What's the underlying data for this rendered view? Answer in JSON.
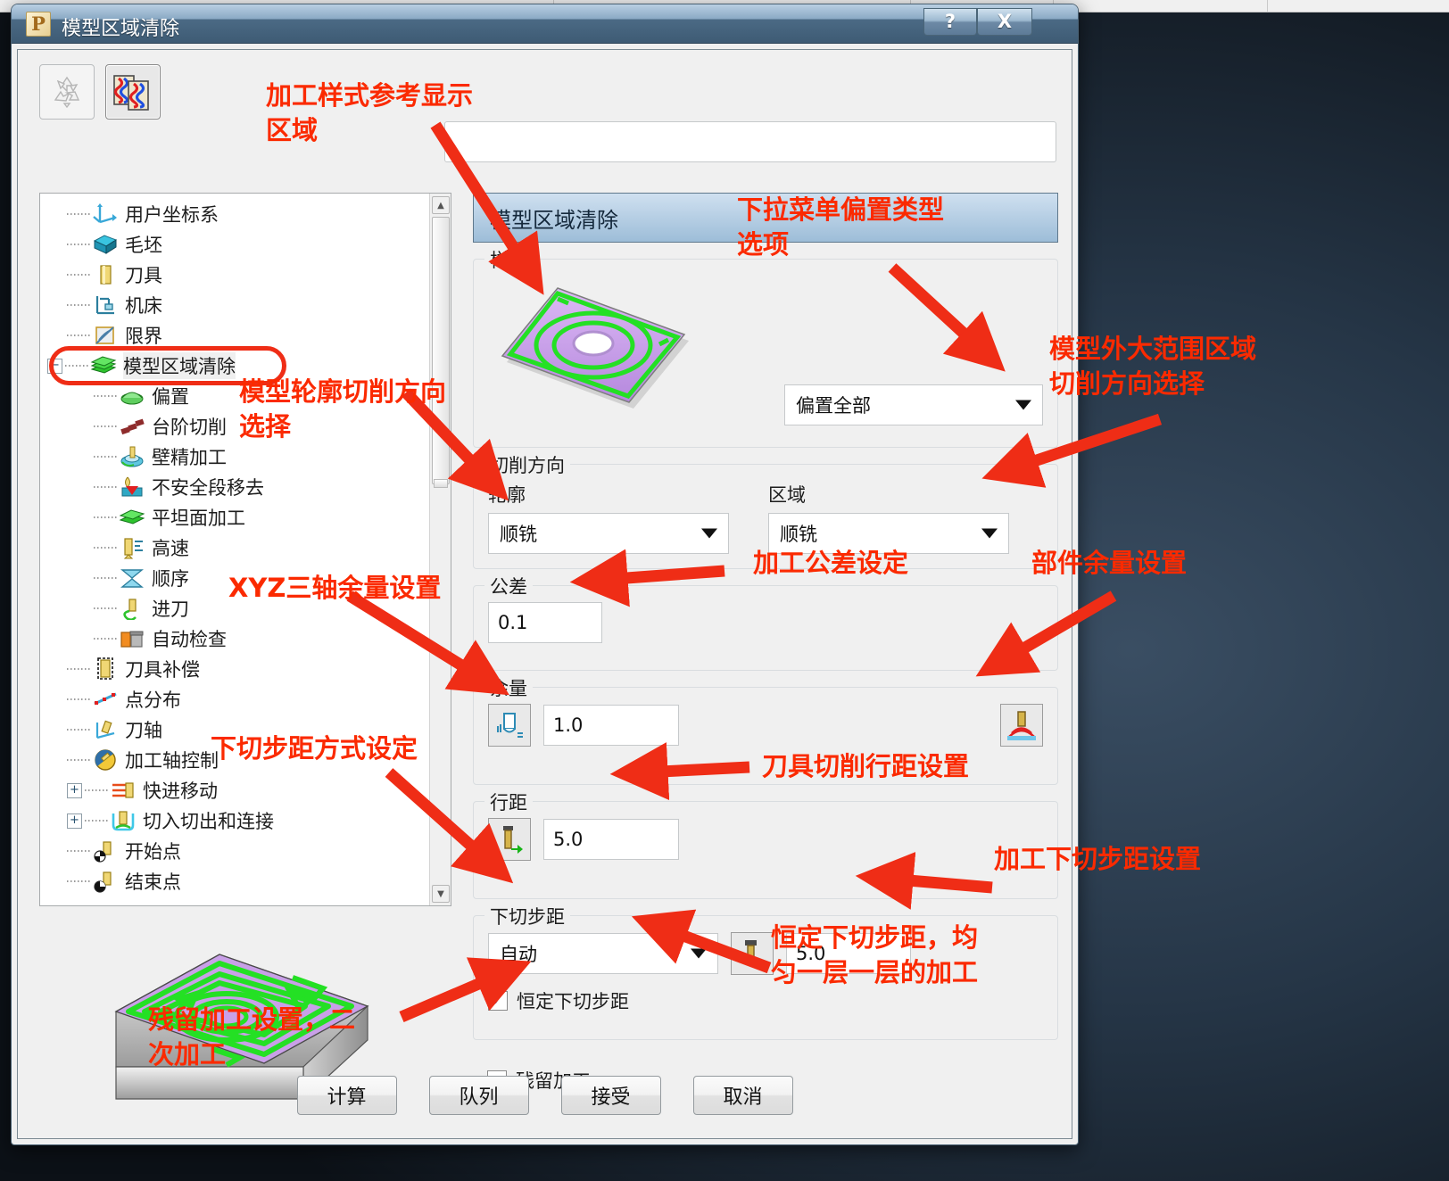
{
  "window": {
    "title": "模型区域清除",
    "app_icon_letter": "P",
    "help_button": "?",
    "close_button": "X"
  },
  "toolbar": {
    "buttons": [
      {
        "name": "recycle-icon",
        "label": ""
      },
      {
        "name": "toolpath-preview-icon",
        "label": ""
      }
    ]
  },
  "tree": {
    "items": [
      {
        "label": "用户坐标系",
        "icon": "axes-icon",
        "depth": 1,
        "expander": "",
        "selected": false
      },
      {
        "label": "毛坯",
        "icon": "block-icon",
        "depth": 1,
        "expander": "",
        "selected": false
      },
      {
        "label": "刀具",
        "icon": "tool-icon",
        "depth": 1,
        "expander": "",
        "selected": false
      },
      {
        "label": "机床",
        "icon": "machine-icon",
        "depth": 1,
        "expander": "",
        "selected": false
      },
      {
        "label": "限界",
        "icon": "limit-icon",
        "depth": 1,
        "expander": "",
        "selected": false
      },
      {
        "label": "模型区域清除",
        "icon": "area-clearance-icon",
        "depth": 0,
        "expander": "−",
        "selected": true
      },
      {
        "label": "偏置",
        "icon": "offset-icon",
        "depth": 2,
        "expander": "",
        "selected": false
      },
      {
        "label": "台阶切削",
        "icon": "step-cut-icon",
        "depth": 2,
        "expander": "",
        "selected": false
      },
      {
        "label": "壁精加工",
        "icon": "wall-finish-icon",
        "depth": 2,
        "expander": "",
        "selected": false
      },
      {
        "label": "不安全段移去",
        "icon": "unsafe-segment-icon",
        "depth": 2,
        "expander": "",
        "selected": false
      },
      {
        "label": "平坦面加工",
        "icon": "flat-machining-icon",
        "depth": 2,
        "expander": "",
        "selected": false
      },
      {
        "label": "高速",
        "icon": "high-speed-icon",
        "depth": 2,
        "expander": "",
        "selected": false
      },
      {
        "label": "顺序",
        "icon": "order-icon",
        "depth": 2,
        "expander": "",
        "selected": false
      },
      {
        "label": "进刀",
        "icon": "lead-in-icon",
        "depth": 2,
        "expander": "",
        "selected": false
      },
      {
        "label": "自动检查",
        "icon": "auto-check-icon",
        "depth": 2,
        "expander": "",
        "selected": false
      },
      {
        "label": "刀具补偿",
        "icon": "tool-compensation-icon",
        "depth": 1,
        "expander": "",
        "selected": false
      },
      {
        "label": "点分布",
        "icon": "point-distribution-icon",
        "depth": 1,
        "expander": "",
        "selected": false
      },
      {
        "label": "刀轴",
        "icon": "tool-axis-icon",
        "depth": 1,
        "expander": "",
        "selected": false
      },
      {
        "label": "加工轴控制",
        "icon": "machine-axis-control-icon",
        "depth": 1,
        "expander": "",
        "selected": false
      },
      {
        "label": "快进移动",
        "icon": "rapid-move-icon",
        "depth": 1,
        "expander": "+",
        "selected": false
      },
      {
        "label": "切入切出和连接",
        "icon": "lead-link-icon",
        "depth": 1,
        "expander": "+",
        "selected": false
      },
      {
        "label": "开始点",
        "icon": "start-point-icon",
        "depth": 1,
        "expander": "",
        "selected": false
      },
      {
        "label": "结束点",
        "icon": "end-point-icon",
        "depth": 1,
        "expander": "",
        "selected": false
      }
    ]
  },
  "form": {
    "header": "模型区域清除",
    "style_group": {
      "label": "样式",
      "preview_icon": "offset-all-pattern-icon",
      "offset_type": "偏置全部"
    },
    "cut_direction_group": {
      "label": "切削方向",
      "profile_label": "轮廓",
      "profile_value": "顺铣",
      "area_label": "区域",
      "area_value": "顺铣"
    },
    "tolerance_group": {
      "label": "公差",
      "value": "0.1"
    },
    "thickness_group": {
      "label": "余量",
      "icon_left": "radial-thickness-icon",
      "value": "1.0",
      "icon_right": "axial-thickness-icon"
    },
    "stepover_group": {
      "label": "行距",
      "icon": "stepover-icon",
      "value": "5.0"
    },
    "stepdown_group": {
      "label": "下切步距",
      "mode": "自动",
      "icon": "stepdown-icon",
      "value": "5.0",
      "constant_stepdown_label": "恒定下切步距",
      "constant_stepdown_checked": true
    },
    "rest_machining": {
      "label": "残留加工",
      "checked": false
    }
  },
  "buttons": [
    {
      "label": "计算",
      "name": "calculate-button"
    },
    {
      "label": "队列",
      "name": "queue-button"
    },
    {
      "label": "接受",
      "name": "accept-button"
    },
    {
      "label": "取消",
      "name": "cancel-button"
    }
  ],
  "annotations": {
    "a1": "加工样式参考显示\n区域",
    "a2": "下拉菜单偏置类型\n选项",
    "a3": "模型外大范围区域\n切削方向选择",
    "a4": "模型轮廓切削方向\n选择",
    "a5": "加工公差设定",
    "a6": "部件余量设置",
    "a7": "XYZ三轴余量设置",
    "a8": "刀具切削行距设置",
    "a9": "下切步距方式设定",
    "a10": "加工下切步距设置",
    "a11": "恒定下切步距，均\n匀一层一层的加工",
    "a12": "残留加工设置，二\n次加工"
  },
  "colors": {
    "annotation": "#fb2a00",
    "title_bar": "#4b6a85",
    "form_header": "#9dbdd8",
    "selection_ring": "#ef2d16",
    "toolpath_green": "#2ee02e",
    "model_purple": "#c9a0e8"
  }
}
